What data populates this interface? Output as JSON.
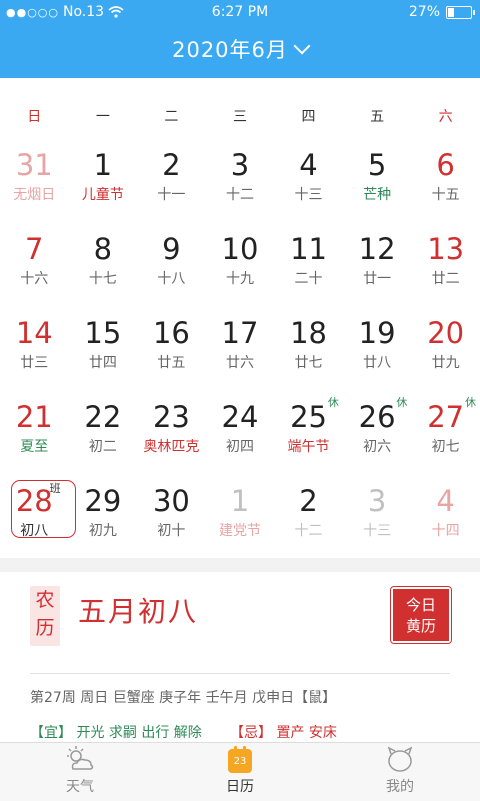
{
  "status": {
    "carrier": "No.13",
    "time": "6:27 PM",
    "battery": "27%",
    "battery_level": 0.27,
    "signal_dots": "●●○○○"
  },
  "header": {
    "title": "2020年6月"
  },
  "weekdays": [
    "日",
    "一",
    "二",
    "三",
    "四",
    "五",
    "六"
  ],
  "weeks": [
    [
      {
        "num": "31",
        "sub": "无烟日",
        "style": "faded",
        "subcolor": ""
      },
      {
        "num": "1",
        "sub": "儿童节",
        "style": "",
        "subcolor": "red"
      },
      {
        "num": "2",
        "sub": "十一",
        "style": ""
      },
      {
        "num": "3",
        "sub": "十二",
        "style": ""
      },
      {
        "num": "4",
        "sub": "十三",
        "style": ""
      },
      {
        "num": "5",
        "sub": "芒种",
        "style": "",
        "subcolor": "green"
      },
      {
        "num": "6",
        "sub": "十五",
        "style": "weekend"
      }
    ],
    [
      {
        "num": "7",
        "sub": "十六",
        "style": "weekend"
      },
      {
        "num": "8",
        "sub": "十七",
        "style": ""
      },
      {
        "num": "9",
        "sub": "十八",
        "style": ""
      },
      {
        "num": "10",
        "sub": "十九",
        "style": ""
      },
      {
        "num": "11",
        "sub": "二十",
        "style": ""
      },
      {
        "num": "12",
        "sub": "廿一",
        "style": ""
      },
      {
        "num": "13",
        "sub": "廿二",
        "style": "weekend"
      }
    ],
    [
      {
        "num": "14",
        "sub": "廿三",
        "style": "weekend"
      },
      {
        "num": "15",
        "sub": "廿四",
        "style": ""
      },
      {
        "num": "16",
        "sub": "廿五",
        "style": ""
      },
      {
        "num": "17",
        "sub": "廿六",
        "style": ""
      },
      {
        "num": "18",
        "sub": "廿七",
        "style": ""
      },
      {
        "num": "19",
        "sub": "廿八",
        "style": ""
      },
      {
        "num": "20",
        "sub": "廿九",
        "style": "weekend"
      }
    ],
    [
      {
        "num": "21",
        "sub": "夏至",
        "style": "weekend",
        "subcolor": "green"
      },
      {
        "num": "22",
        "sub": "初二",
        "style": ""
      },
      {
        "num": "23",
        "sub": "奥林匹克",
        "style": "",
        "subcolor": "red"
      },
      {
        "num": "24",
        "sub": "初四",
        "style": ""
      },
      {
        "num": "25",
        "sub": "端午节",
        "style": "",
        "subcolor": "red",
        "badge": "休"
      },
      {
        "num": "26",
        "sub": "初六",
        "style": "",
        "badge": "休"
      },
      {
        "num": "27",
        "sub": "初七",
        "style": "weekend",
        "badge": "休"
      }
    ],
    [
      {
        "num": "28",
        "sub": "初八",
        "style": "today",
        "badge": "班"
      },
      {
        "num": "29",
        "sub": "初九",
        "style": ""
      },
      {
        "num": "30",
        "sub": "初十",
        "style": ""
      },
      {
        "num": "1",
        "sub": "建党节",
        "style": "faded grey-num"
      },
      {
        "num": "2",
        "sub": "十二",
        "style": "faded-dark"
      },
      {
        "num": "3",
        "sub": "十三",
        "style": "faded grey"
      },
      {
        "num": "4",
        "sub": "十四",
        "style": "faded"
      }
    ]
  ],
  "info": {
    "nongli_label_1": "农",
    "nongli_label_2": "历",
    "lunar_date": "五月初八",
    "huangli_1": "今日",
    "huangli_2": "黄历",
    "detail": "第27周 周日 巨蟹座 庚子年 壬午月 戊申日【鼠】",
    "yi": "【宜】 开光 求嗣 出行 解除",
    "ji": "【忌】 置产 安床"
  },
  "tabs": [
    {
      "label": "天气",
      "icon": "weather-icon",
      "active": false
    },
    {
      "label": "日历",
      "icon": "calendar-icon",
      "active": true,
      "icon_text": "23"
    },
    {
      "label": "我的",
      "icon": "profile-icon",
      "active": false
    }
  ],
  "colors": {
    "header": "#3aa9f2",
    "accent": "#d03030",
    "festival_green": "#2e8b57",
    "tab_active": "#f5a623"
  }
}
